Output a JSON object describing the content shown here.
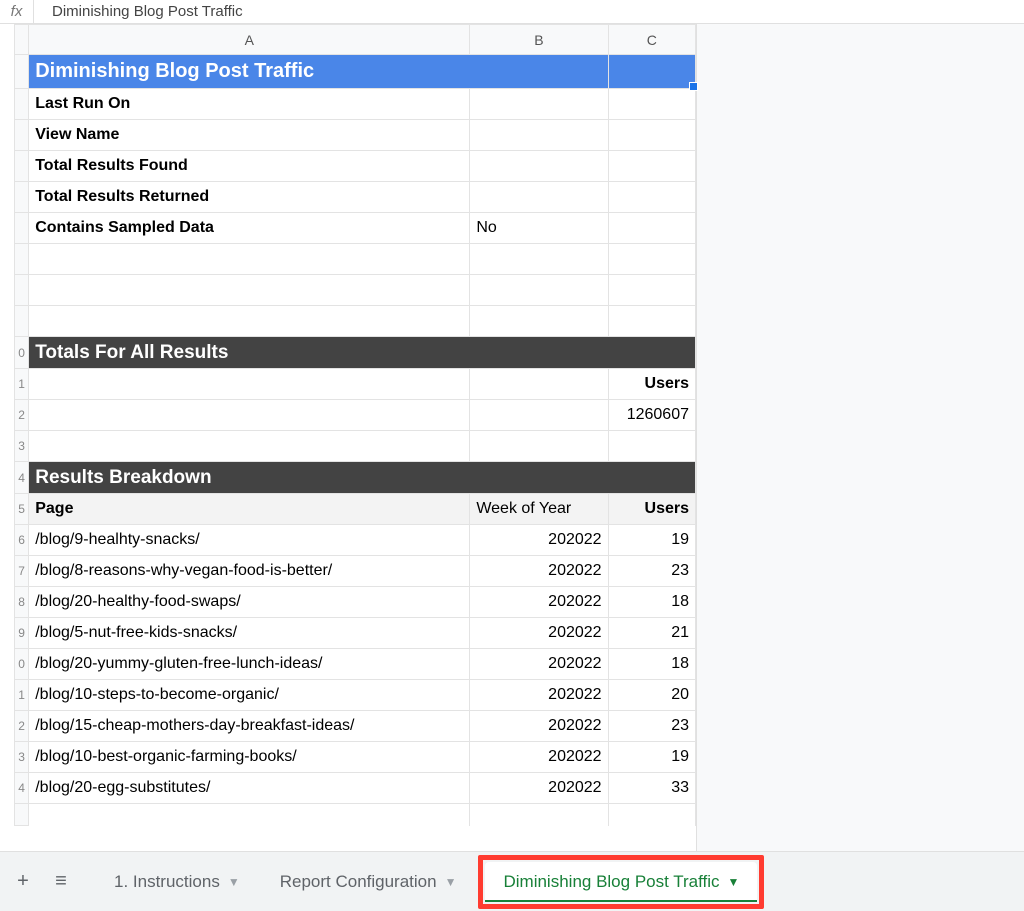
{
  "formula_bar": {
    "fx": "fx",
    "value": "Diminishing Blog Post Traffic"
  },
  "columns": [
    "A",
    "B",
    "C"
  ],
  "row_numbers": [
    "",
    "",
    "",
    "",
    "",
    "",
    "",
    "",
    "",
    "0",
    "1",
    "2",
    "3",
    "4",
    "5",
    "6",
    "7",
    "8",
    "9",
    "0",
    "1",
    "2",
    "3",
    "4",
    ""
  ],
  "title_row": {
    "text": "Diminishing Blog Post Traffic"
  },
  "meta_rows": [
    {
      "label": "Last Run On",
      "b": "",
      "c": ""
    },
    {
      "label": "View Name",
      "b": "",
      "c": ""
    },
    {
      "label": "Total Results Found",
      "b": "",
      "c": ""
    },
    {
      "label": "Total Results Returned",
      "b": "",
      "c": ""
    },
    {
      "label": "Contains Sampled Data",
      "b": "No",
      "c": ""
    }
  ],
  "section_totals": "Totals For All Results",
  "totals_header": {
    "a": "",
    "b": "",
    "c": "Users"
  },
  "totals_value": {
    "a": "",
    "b": "",
    "c": "1260607"
  },
  "section_breakdown": "Results Breakdown",
  "breakdown_header": {
    "a": "Page",
    "b": "Week of Year",
    "c": "Users"
  },
  "breakdown_rows": [
    {
      "page": "/blog/9-healhty-snacks/",
      "week": "202022",
      "users": "19"
    },
    {
      "page": "/blog/8-reasons-why-vegan-food-is-better/",
      "week": "202022",
      "users": "23"
    },
    {
      "page": "/blog/20-healthy-food-swaps/",
      "week": "202022",
      "users": "18"
    },
    {
      "page": "/blog/5-nut-free-kids-snacks/",
      "week": "202022",
      "users": "21"
    },
    {
      "page": "/blog/20-yummy-gluten-free-lunch-ideas/",
      "week": "202022",
      "users": "18"
    },
    {
      "page": "/blog/10-steps-to-become-organic/",
      "week": "202022",
      "users": "20"
    },
    {
      "page": "/blog/15-cheap-mothers-day-breakfast-ideas/",
      "week": "202022",
      "users": "23"
    },
    {
      "page": "/blog/10-best-organic-farming-books/",
      "week": "202022",
      "users": "19"
    },
    {
      "page": "/blog/20-egg-substitutes/",
      "week": "202022",
      "users": "33"
    }
  ],
  "tabs": {
    "add_icon": "+",
    "menu_icon": "≡",
    "tab1": "1. Instructions",
    "tab2": "Report Configuration",
    "tab3": "Diminishing Blog Post Traffic",
    "caret": "▼"
  }
}
